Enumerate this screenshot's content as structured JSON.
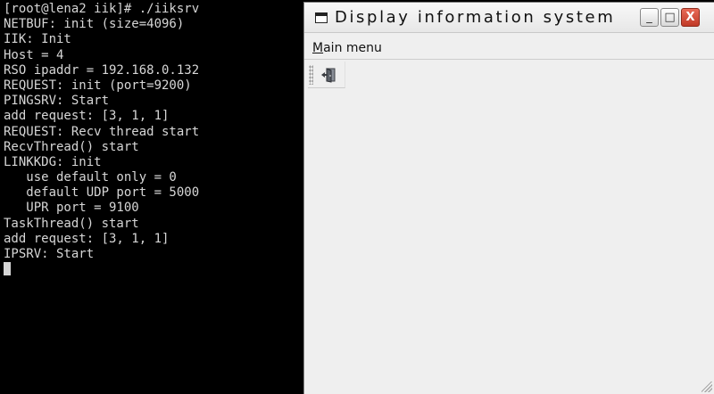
{
  "terminal": {
    "lines": [
      "[root@lena2 iik]# ./iiksrv",
      "NETBUF: init (size=4096)",
      "IIK: Init",
      "Host = 4",
      "RSO ipaddr = 192.168.0.132",
      "REQUEST: init (port=9200)",
      "PINGSRV: Start",
      "add request: [3, 1, 1]",
      "REQUEST: Recv thread start",
      "RecvThread() start",
      "LINKKDG: init",
      "   use default only = 0",
      "   default UDP port = 5000",
      "   UPR port = 9100",
      "TaskThread() start",
      "add request: [3, 1, 1]",
      "IPSRV: Start"
    ],
    "background": "#000000",
    "foreground": "#d6d6d6"
  },
  "window": {
    "title": "Display information system",
    "title_icon": "window-icon",
    "buttons": {
      "minimize": "_",
      "maximize": "□",
      "close": "X"
    },
    "menu": {
      "main_accel": "M",
      "main_rest": "ain menu"
    },
    "toolbar": {
      "items": [
        {
          "icon": "exit-door-icon"
        }
      ]
    },
    "close_color": "#c03a27"
  }
}
